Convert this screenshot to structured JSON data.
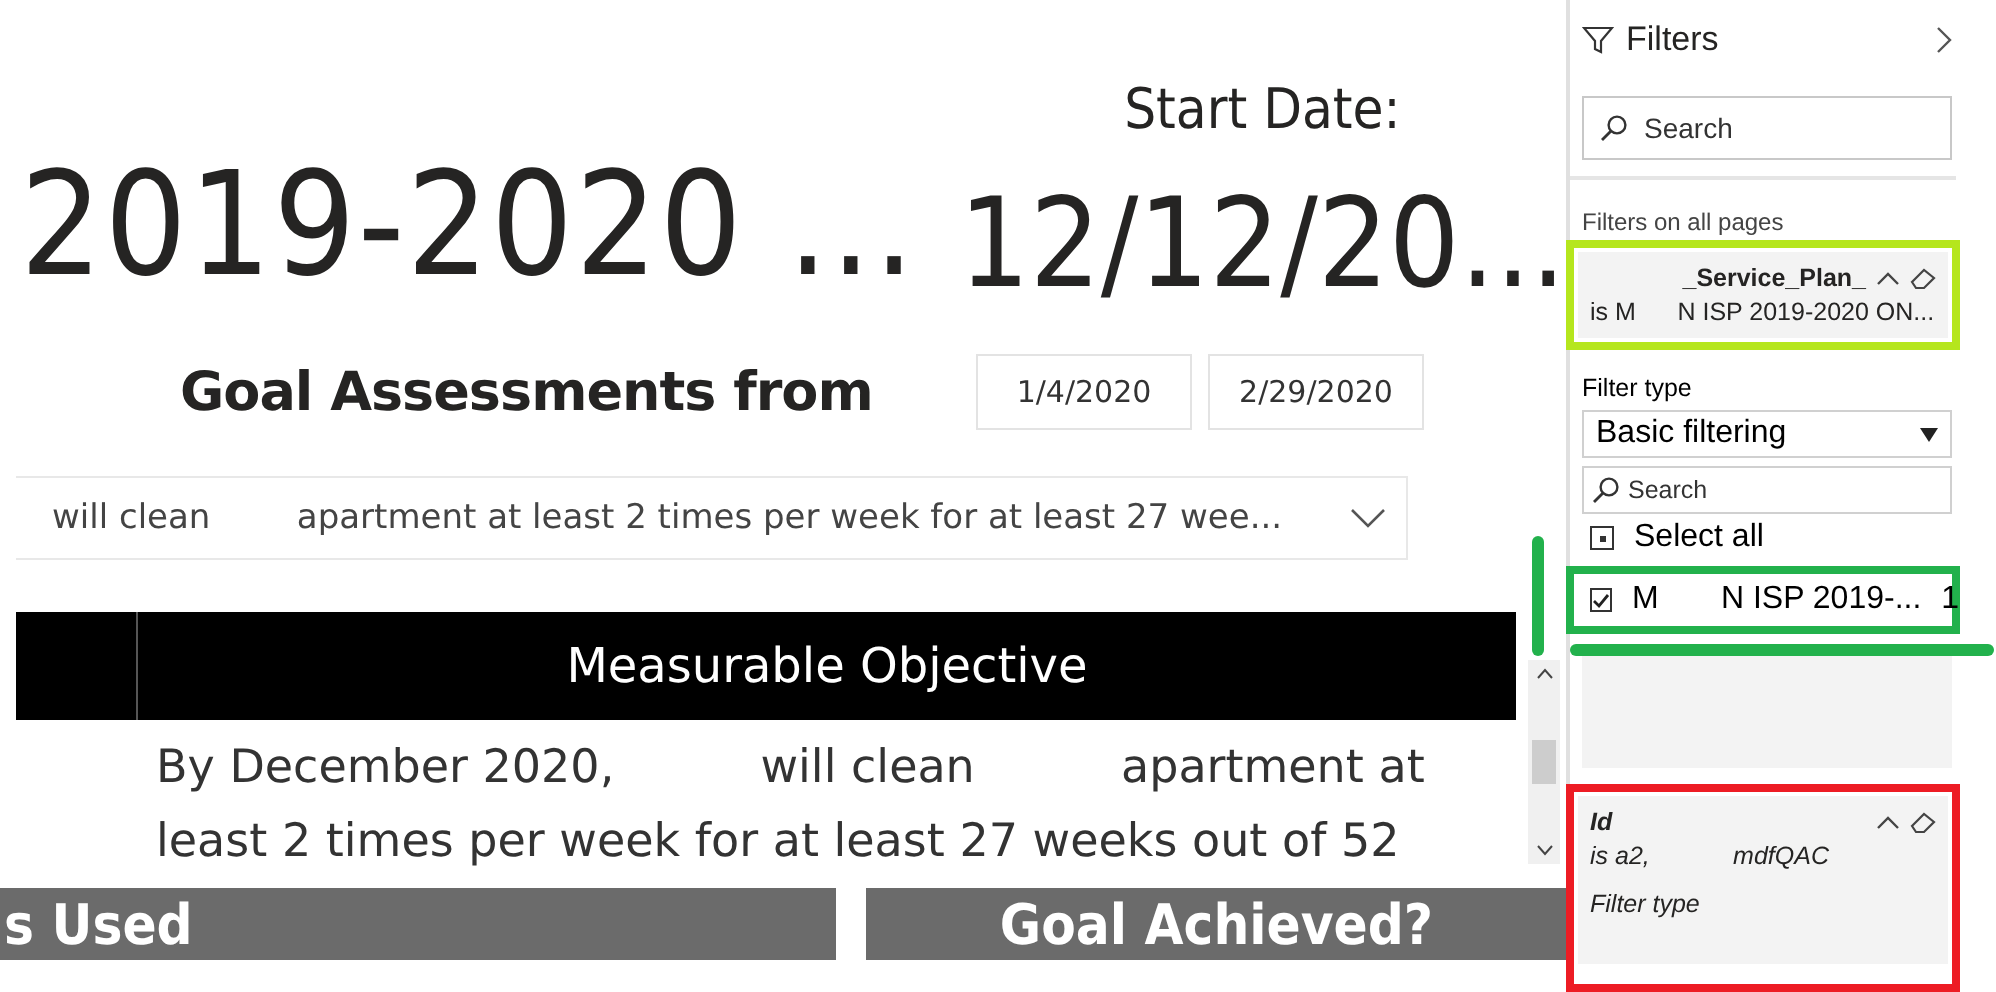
{
  "report": {
    "title": "2019-2020 ...",
    "start_date_label": "Start Date:",
    "start_date": "12/12/20...",
    "range_label": "Goal Assessments from",
    "range_from": "1/4/2020",
    "range_to": "2/29/2020",
    "goal_dropdown": "will clean        apartment at least 2 times per week for at least 27 wee...",
    "table": {
      "columns": [
        "Measurable Objective"
      ],
      "rows": [
        [
          "By December 2020,          will clean          apartment at least 2 times per week for at least 27 weeks out of 52"
        ]
      ]
    },
    "section_headers": [
      "s Used",
      "Goal Achieved?"
    ]
  },
  "filters": {
    "title": "Filters",
    "search": {
      "placeholder": "Search"
    },
    "section_label": "Filters on all pages",
    "cards": [
      {
        "kind": "list",
        "title": "_Service_Plan_",
        "summary": "is M      N ISP 2019-2020 ON...",
        "color": "#b5e61d",
        "filter_type_label": "Filter type",
        "filter_type": "Basic filtering",
        "search": {
          "placeholder": "Search"
        },
        "select_all": {
          "label": "Select all",
          "indeterminate": true
        },
        "items": [
          {
            "label": "M       N ISP 2019-...",
            "count": "1",
            "checked": true,
            "color": "#22b14c"
          }
        ]
      },
      {
        "kind": "collapsed",
        "title": "Id",
        "summary": "is a2,            mdfQAC",
        "filter_type_label": "Filter type",
        "color": "#ed1c24"
      }
    ]
  }
}
